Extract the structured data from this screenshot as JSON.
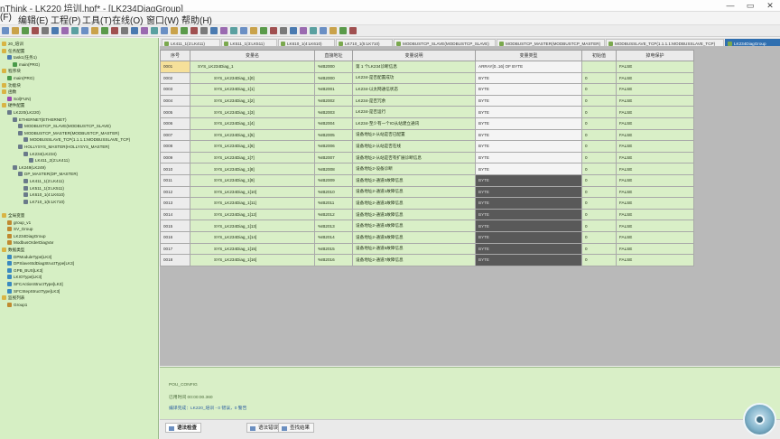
{
  "window": {
    "title": "nThink - LK220 培训.hpf* - [LK234DiagGroup]",
    "buttons": [
      "—",
      "▭",
      "✕"
    ]
  },
  "menu": [
    "(F)",
    "编辑(E)",
    "工程(P)",
    "工具(T)",
    "在线(O)",
    "窗口(W)",
    "帮助(H)"
  ],
  "tree": [
    {
      "text": "20_培训",
      "level": 0,
      "icon": "folder"
    },
    {
      "text": "任务配置",
      "level": 0,
      "icon": "folder"
    },
    {
      "text": "task1(任务1)",
      "level": 1,
      "icon": "task"
    },
    {
      "text": "main(PRG)",
      "level": 2,
      "icon": "prg"
    },
    {
      "text": "程序块",
      "level": 0,
      "icon": "folder"
    },
    {
      "text": "main(PRG)",
      "level": 1,
      "icon": "prg"
    },
    {
      "text": "功能块",
      "level": 0,
      "icon": "folder"
    },
    {
      "text": "函数",
      "level": 0,
      "icon": "folder"
    },
    {
      "text": "Sol(FUN)",
      "level": 1,
      "icon": "fun"
    },
    {
      "text": "硬件配置",
      "level": 0,
      "icon": "folder"
    },
    {
      "text": "LK220(LK220)",
      "level": 1,
      "icon": "hw"
    },
    {
      "text": "ETHERNET(ETHERNET)",
      "level": 2,
      "icon": "hw"
    },
    {
      "text": "MODBUSTCP_SLAVE(MODBUSTCP_SLAVE)",
      "level": 3,
      "icon": "hw"
    },
    {
      "text": "MODBUSTCP_MASTER(MODBUSTCP_MASTER)",
      "level": 3,
      "icon": "hw"
    },
    {
      "text": "MODBUSSLAVE_TCP(1.1.1.1:MODBUSSLAVE_TCP)",
      "level": 4,
      "icon": "hw"
    },
    {
      "text": "HOLLYSYS_MASTER(HOLLYSYS_MASTER)",
      "level": 3,
      "icon": "hw"
    },
    {
      "text": "LK234(LK234)",
      "level": 4,
      "icon": "hw"
    },
    {
      "text": "LK411_2(2:LK411)",
      "level": 5,
      "icon": "hw"
    },
    {
      "text": "LK249(LK249)",
      "level": 2,
      "icon": "hw"
    },
    {
      "text": "DP_MASTER(DP_MASTER)",
      "level": 3,
      "icon": "hw"
    },
    {
      "text": "LK411_1(2:LK411)",
      "level": 4,
      "icon": "hw"
    },
    {
      "text": "LK511_1(3:LK511)",
      "level": 4,
      "icon": "hw"
    },
    {
      "text": "LK610_1(4:LK610)",
      "level": 4,
      "icon": "hw"
    },
    {
      "text": "LK710_1(5:LK710)",
      "level": 4,
      "icon": "hw"
    },
    {
      "text": "",
      "level": 0,
      "icon": "none"
    },
    {
      "text": "全局变量",
      "level": 0,
      "icon": "folder"
    },
    {
      "text": "group_v1",
      "level": 1,
      "icon": "var"
    },
    {
      "text": "SV_Group",
      "level": 1,
      "icon": "var"
    },
    {
      "text": "LK234DiagGroup",
      "level": 1,
      "icon": "var"
    },
    {
      "text": "ModbusOrderDiagVar",
      "level": 1,
      "icon": "var"
    },
    {
      "text": "数据类型",
      "level": 0,
      "icon": "folder"
    },
    {
      "text": "DPModuleType[LK3]",
      "level": 1,
      "icon": "dtype"
    },
    {
      "text": "DPSlaveStdDiagStructType[LK3]",
      "level": 1,
      "icon": "dtype"
    },
    {
      "text": "GPB_BUS[LK3]",
      "level": 1,
      "icon": "dtype"
    },
    {
      "text": "LKIOType[LK3]",
      "level": 1,
      "icon": "dtype"
    },
    {
      "text": "SFCActionStructType[LK3]",
      "level": 1,
      "icon": "dtype"
    },
    {
      "text": "SFCStepStructType[LK3]",
      "level": 1,
      "icon": "dtype"
    },
    {
      "text": "监视列表",
      "level": 0,
      "icon": "folder"
    },
    {
      "text": "Group1",
      "level": 1,
      "icon": "var"
    }
  ],
  "tabs": [
    {
      "label": "LK411_1(2:LK411)",
      "active": false
    },
    {
      "label": "LK511_1(3:LK511)",
      "active": false
    },
    {
      "label": "LK610_1(4:LK610)",
      "active": false
    },
    {
      "label": "LK710_1(5:LK710)",
      "active": false
    },
    {
      "label": "MODBUSTCP_SLAVE(MODBUSTCP_SLAVE)",
      "active": false
    },
    {
      "label": "MODBUSTCP_MASTER(MODBUSTCP_MASTER)",
      "active": false
    },
    {
      "label": "MODBUSSLAVE_TCP(1.1.1.1:MODBUSSLAVE_TCP)",
      "active": false
    },
    {
      "label": "LK234DiagGroup",
      "active": true
    }
  ],
  "grid": {
    "headers": [
      "序号",
      "变量名",
      "直接地址",
      "变量说明",
      "变量类型",
      "初始值",
      "掉电保护"
    ],
    "rows": [
      {
        "no": "0001",
        "name": "SYS_LK234Diag_1",
        "addr": "%IB2000",
        "desc": "第 1 个LK234诊断信息",
        "type": "ARRAY[0..16] OF BYTE",
        "init": "",
        "retain": "FALSE",
        "shade": "light",
        "top": true
      },
      {
        "no": "0002",
        "name": "SYS_LK234Diag_1[0]",
        "addr": "%IB2000",
        "desc": "LK234-是否配置成功",
        "type": "BYTE",
        "init": "0",
        "retain": "FALSE",
        "shade": "light"
      },
      {
        "no": "0003",
        "name": "SYS_LK234Diag_1[1]",
        "addr": "%IB2001",
        "desc": "LK234-以太网通信状态",
        "type": "BYTE",
        "init": "0",
        "retain": "FALSE",
        "shade": "light"
      },
      {
        "no": "0004",
        "name": "SYS_LK234Diag_1[2]",
        "addr": "%IB2002",
        "desc": "LK234-是否冗余",
        "type": "BYTE",
        "init": "0",
        "retain": "FALSE",
        "shade": "light"
      },
      {
        "no": "0005",
        "name": "SYS_LK234Diag_1[3]",
        "addr": "%IB2003",
        "desc": "LK234-是否运行",
        "type": "BYTE",
        "init": "0",
        "retain": "FALSE",
        "shade": "light"
      },
      {
        "no": "0006",
        "name": "SYS_LK234Diag_1[4]",
        "addr": "%IB2004",
        "desc": "LK234-至少有一个IO从站建立通讯",
        "type": "BYTE",
        "init": "0",
        "retain": "FALSE",
        "shade": "light"
      },
      {
        "no": "0007",
        "name": "SYS_LK234Diag_1[5]",
        "addr": "%IB2005",
        "desc": "设备地址2-从站是否已配置",
        "type": "BYTE",
        "init": "0",
        "retain": "FALSE",
        "shade": "light"
      },
      {
        "no": "0008",
        "name": "SYS_LK234Diag_1[6]",
        "addr": "%IB2006",
        "desc": "设备地址2-从站是否在线",
        "type": "BYTE",
        "init": "0",
        "retain": "FALSE",
        "shade": "light"
      },
      {
        "no": "0009",
        "name": "SYS_LK234Diag_1[7]",
        "addr": "%IB2007",
        "desc": "设备地址2-从站是否有扩展诊断信息",
        "type": "BYTE",
        "init": "0",
        "retain": "FALSE",
        "shade": "light"
      },
      {
        "no": "0010",
        "name": "SYS_LK234Diag_1[8]",
        "addr": "%IB2008",
        "desc": "设备地址2-设备诊断",
        "type": "BYTE",
        "init": "0",
        "retain": "FALSE",
        "shade": "light"
      },
      {
        "no": "0011",
        "name": "SYS_LK234Diag_1[9]",
        "addr": "%IB2009",
        "desc": "设备地址2-通道0故障信息",
        "type": "BYTE",
        "init": "0",
        "retain": "FALSE",
        "shade": "dark"
      },
      {
        "no": "0012",
        "name": "SYS_LK234Diag_1[10]",
        "addr": "%IB2010",
        "desc": "设备地址2-通道1故障信息",
        "type": "BYTE",
        "init": "0",
        "retain": "FALSE",
        "shade": "dark"
      },
      {
        "no": "0013",
        "name": "SYS_LK234Diag_1[11]",
        "addr": "%IB2011",
        "desc": "设备地址2-通道2故障信息",
        "type": "BYTE",
        "init": "0",
        "retain": "FALSE",
        "shade": "dark"
      },
      {
        "no": "0014",
        "name": "SYS_LK234Diag_1[12]",
        "addr": "%IB2012",
        "desc": "设备地址2-通道3故障信息",
        "type": "BYTE",
        "init": "0",
        "retain": "FALSE",
        "shade": "dark"
      },
      {
        "no": "0015",
        "name": "SYS_LK234Diag_1[13]",
        "addr": "%IB2013",
        "desc": "设备地址2-通道4故障信息",
        "type": "BYTE",
        "init": "0",
        "retain": "FALSE",
        "shade": "dark"
      },
      {
        "no": "0016",
        "name": "SYS_LK234Diag_1[14]",
        "addr": "%IB2014",
        "desc": "设备地址2-通道5故障信息",
        "type": "BYTE",
        "init": "0",
        "retain": "FALSE",
        "shade": "dark"
      },
      {
        "no": "0017",
        "name": "SYS_LK234Diag_1[15]",
        "addr": "%IB2015",
        "desc": "设备地址2-通道6故障信息",
        "type": "BYTE",
        "init": "0",
        "retain": "FALSE",
        "shade": "dark"
      },
      {
        "no": "0018",
        "name": "SYS_LK234Diag_1[16]",
        "addr": "%IB2016",
        "desc": "设备地址2-通道7故障信息",
        "type": "BYTE",
        "init": "0",
        "retain": "FALSE",
        "shade": "dark"
      }
    ]
  },
  "output": {
    "lines": [
      "POU_CONFIG",
      "已用时间 00:00:00.360",
      "编译完成：LK220_培训 - 0 错误，0 警告"
    ]
  },
  "bottom_tabs": [
    {
      "label": "语法检查",
      "active": true
    },
    {
      "label": "语法错误",
      "active": false
    },
    {
      "label": "查找结果",
      "active": false
    }
  ],
  "colors": {
    "tree_bg": "#d6efc4",
    "grid_bg": "#d9efc7",
    "type_dark": "#595959",
    "active_tab": "#2f6fb0"
  }
}
